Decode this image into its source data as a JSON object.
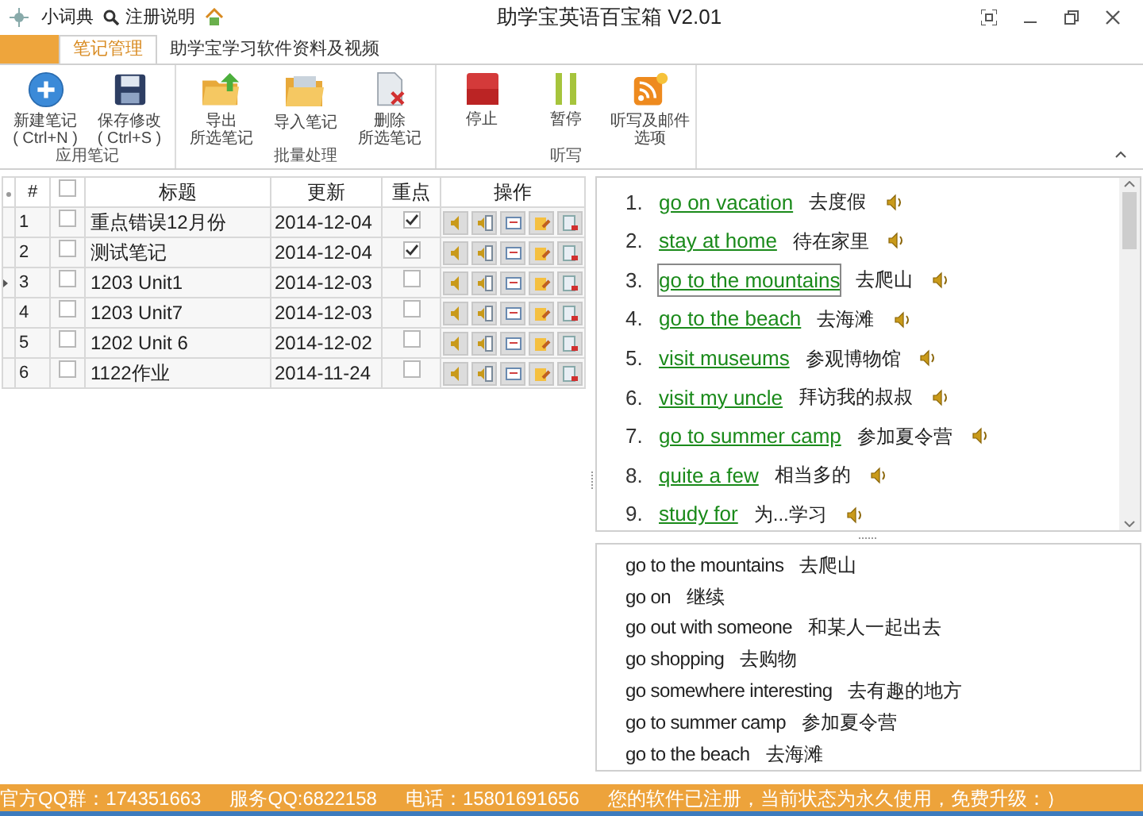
{
  "title_bar": {
    "links": [
      {
        "label": "小词典",
        "kind": "dictionary"
      },
      {
        "label": "注册说明",
        "kind": "search"
      }
    ],
    "title": "助学宝英语百宝箱 V2.01"
  },
  "tabs": [
    {
      "label": "笔记管理",
      "selected": true
    },
    {
      "label": "助学宝学习软件资料及视频",
      "selected": false
    }
  ],
  "ribbon": {
    "groups": [
      {
        "label": "应用笔记",
        "buttons": [
          {
            "lines": [
              "新建笔记",
              "( Ctrl+N )"
            ],
            "kind": "add"
          },
          {
            "lines": [
              "保存修改",
              "( Ctrl+S )"
            ],
            "kind": "save"
          }
        ]
      },
      {
        "label": "批量处理",
        "buttons": [
          {
            "lines": [
              "导出",
              "所选笔记"
            ],
            "kind": "export"
          },
          {
            "lines": [
              "导入笔记"
            ],
            "kind": "import"
          },
          {
            "lines": [
              "删除",
              "所选笔记"
            ],
            "kind": "delete"
          }
        ]
      },
      {
        "label": "听写",
        "buttons": [
          {
            "lines": [
              "停止"
            ],
            "kind": "stop"
          },
          {
            "lines": [
              "暂停"
            ],
            "kind": "pause"
          },
          {
            "lines": [
              "听写及邮件",
              "选项"
            ],
            "kind": "options"
          }
        ]
      }
    ]
  },
  "notes_table": {
    "columns": [
      "#",
      "标题",
      "更新",
      "重点",
      "操作"
    ],
    "all_checked": false,
    "rows": [
      {
        "index": "1",
        "title": "重点错误12月份",
        "date": "2014-12-04",
        "checked": false,
        "important": true,
        "current": false
      },
      {
        "index": "2",
        "title": "测试笔记",
        "date": "2014-12-04",
        "checked": false,
        "important": true,
        "current": false
      },
      {
        "index": "3",
        "title": "1203 Unit1",
        "date": "2014-12-03",
        "checked": false,
        "important": false,
        "current": true
      },
      {
        "index": "4",
        "title": "1203 Unit7",
        "date": "2014-12-03",
        "checked": false,
        "important": false,
        "current": false
      },
      {
        "index": "5",
        "title": "1202 Unit 6",
        "date": "2014-12-02",
        "checked": false,
        "important": false,
        "current": false
      },
      {
        "index": "6",
        "title": "1122作业",
        "date": "2014-11-24",
        "checked": false,
        "important": false,
        "current": false
      }
    ]
  },
  "word_list": [
    {
      "number": "1.",
      "phrase": "go on vacation",
      "meaning": "去度假",
      "focused": false
    },
    {
      "number": "2.",
      "phrase": "stay at home",
      "meaning": "待在家里",
      "focused": false
    },
    {
      "number": "3.",
      "phrase": "go to the mountains",
      "meaning": "去爬山",
      "focused": true
    },
    {
      "number": "4.",
      "phrase": "go to the beach",
      "meaning": "去海滩",
      "focused": false
    },
    {
      "number": "5.",
      "phrase": "visit museums",
      "meaning": "参观博物馆",
      "focused": false
    },
    {
      "number": "6.",
      "phrase": "visit my uncle",
      "meaning": "拜访我的叔叔",
      "focused": false
    },
    {
      "number": "7.",
      "phrase": "go to summer camp",
      "meaning": "参加夏令营",
      "focused": false
    },
    {
      "number": "8.",
      "phrase": "quite a few",
      "meaning": "相当多的",
      "focused": false
    },
    {
      "number": "9.",
      "phrase": "study for",
      "meaning": "为...学习",
      "focused": false
    }
  ],
  "phrase_list": [
    {
      "phrase": "go to the mountains",
      "meaning": "去爬山"
    },
    {
      "phrase": "go on",
      "meaning": "继续"
    },
    {
      "phrase": "go out with someone",
      "meaning": "和某人一起出去"
    },
    {
      "phrase": "go shopping",
      "meaning": "去购物"
    },
    {
      "phrase": "go somewhere interesting",
      "meaning": "去有趣的地方"
    },
    {
      "phrase": "go to summer camp",
      "meaning": "参加夏令营"
    },
    {
      "phrase": "go to the beach",
      "meaning": "去海滩"
    }
  ],
  "status_bar": [
    "官方QQ群：174351663",
    "服务QQ:6822158",
    "电话：15801691656",
    "您的软件已注册，当前状态为永久使用，免费升级：）"
  ]
}
